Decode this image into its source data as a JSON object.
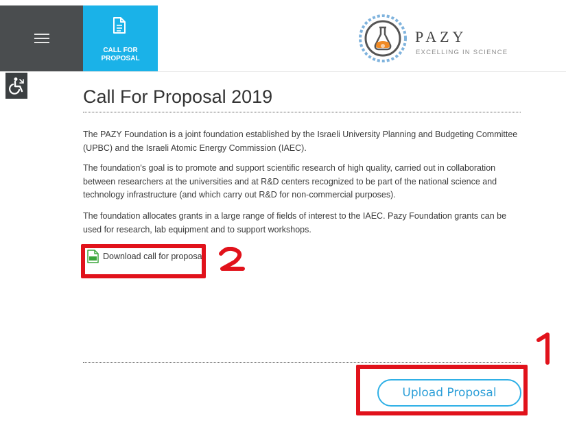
{
  "header": {
    "menu_icon": "hamburger-icon",
    "tab": {
      "label": "CALL FOR\nPROPOSAL",
      "icon": "document-icon"
    },
    "logo": {
      "name": "PAZY",
      "tagline": "EXCELLING IN SCIENCE"
    }
  },
  "accessibility": {
    "icon": "wheelchair-icon"
  },
  "main": {
    "title": "Call For Proposal 2019",
    "paragraphs": [
      "The PAZY Foundation is a joint foundation established by the Israeli University Planning and Budgeting Committee (UPBC) and the Israeli Atomic Energy Commission (IAEC).",
      "The foundation's goal is to promote and support scientific research of high quality, carried out in collaboration between researchers at the universities and at R&D centers recognized to be part of the national science and technology infrastructure (and which carry out R&D for non-commercial purposes).",
      "The foundation allocates grants in a large range of fields of interest to the IAEC. Pazy Foundation grants can be used for research, lab equipment and to support workshops."
    ],
    "download_link": "Download call for proposal",
    "upload_button": "Upload Proposal"
  },
  "annotations": {
    "first": "1",
    "second": "2"
  },
  "colors": {
    "accent": "#1ab2e8",
    "menu_bg": "#4a4d4f",
    "annotation": "#e1121b",
    "upload_border": "#2fb0e6"
  }
}
